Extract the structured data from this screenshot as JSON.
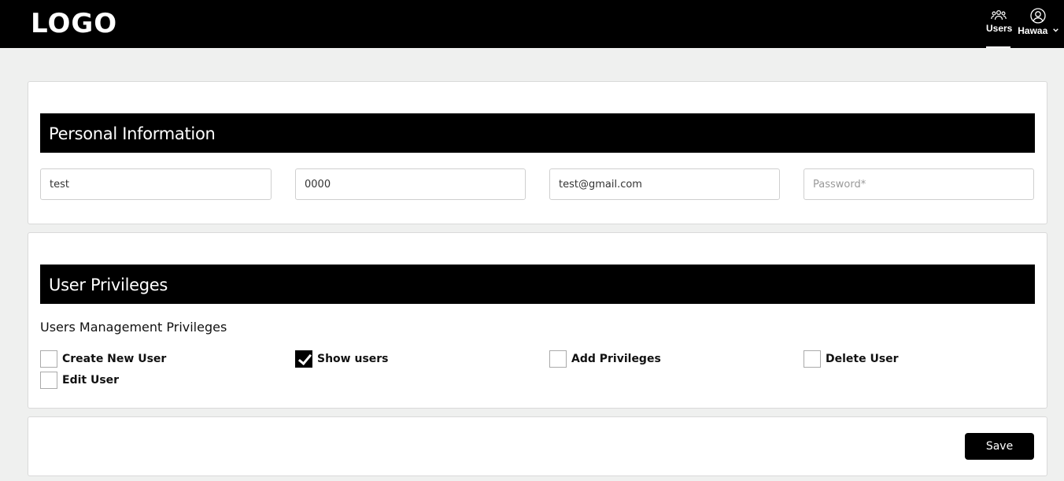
{
  "header": {
    "logo": "LOGO",
    "nav_users_label": "Users",
    "user_name": "Hawaa",
    "users_icon": "users-group-icon",
    "user_icon": "user-circle-icon",
    "chevron_icon": "chevron-down-icon"
  },
  "personal_info": {
    "title": "Personal Information",
    "fields": [
      {
        "value": "test",
        "placeholder": ""
      },
      {
        "value": "0000",
        "placeholder": ""
      },
      {
        "value": "test@gmail.com",
        "placeholder": ""
      },
      {
        "value": "",
        "placeholder": "Password*"
      }
    ]
  },
  "privileges": {
    "title": "User Privileges",
    "group_title": "Users Management Privileges",
    "items": [
      {
        "label": "Create New User",
        "checked": false
      },
      {
        "label": "Show users",
        "checked": true
      },
      {
        "label": "Add Privileges",
        "checked": false
      },
      {
        "label": "Delete User",
        "checked": false
      },
      {
        "label": "Edit User",
        "checked": false
      }
    ]
  },
  "actions": {
    "save_label": "Save"
  },
  "colors": {
    "header_bg": "#000000",
    "page_bg": "#eff0ef",
    "section_header_bg": "#000000",
    "button_bg": "#000000"
  }
}
